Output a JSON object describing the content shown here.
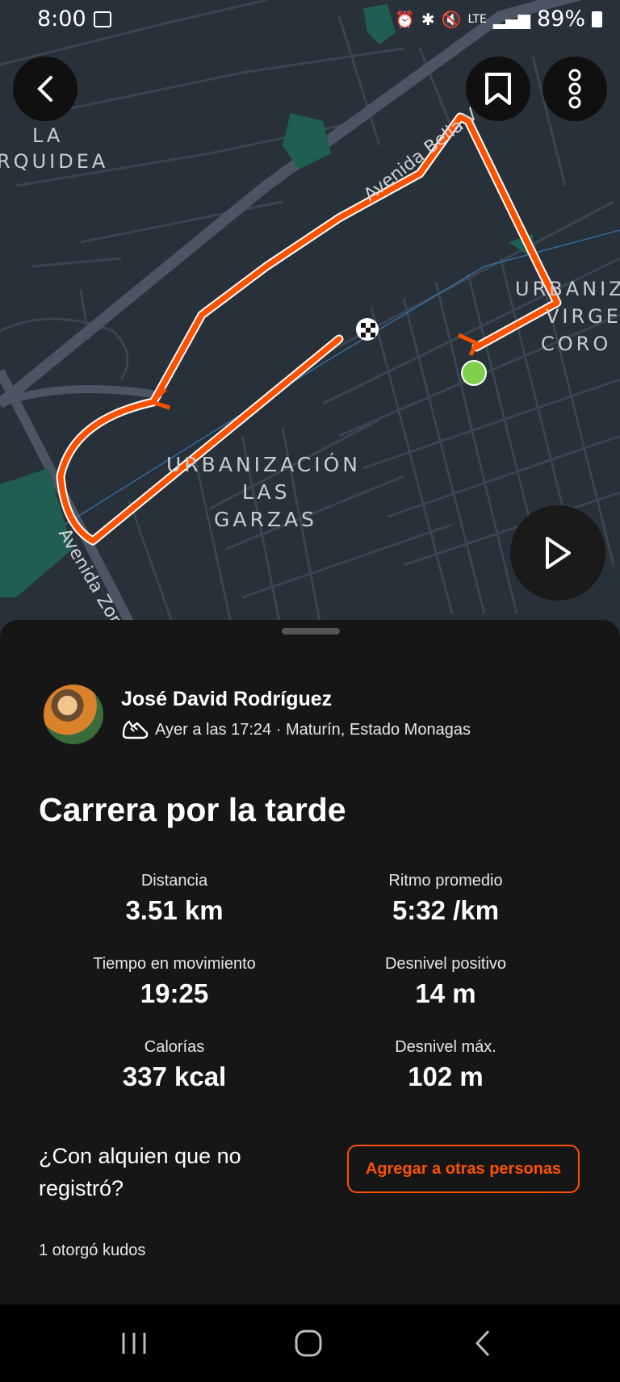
{
  "status_bar": {
    "time": "8:00",
    "net": "LTE",
    "battery": "89%"
  },
  "map": {
    "labels": {
      "la": "LA",
      "orquidea": "RQUIDEA",
      "avenida_bella": "Avenida Bella V",
      "urbaniz_1": "URBANIZ",
      "virge": "VIRGE",
      "coro": "CORO",
      "urb_garzas_1": "URBANIZACIÓN",
      "urb_garzas_2": "LAS",
      "urb_garzas_3": "GARZAS",
      "avenida_zon": "Avenida Zon"
    },
    "colors": {
      "route": "#fc5200",
      "start": "#7fd14a",
      "bg": "#283039",
      "park": "#1f5e51"
    }
  },
  "header": {
    "icons": [
      "back-icon",
      "bookmark-icon",
      "more-vertical-icon"
    ]
  },
  "activity": {
    "athlete_name": "José David Rodríguez",
    "meta": "Ayer a las 17:24 · Maturín, Estado Monagas",
    "title": "Carrera por la tarde",
    "stats": {
      "distance": {
        "label": "Distancia",
        "value": "3.51 km"
      },
      "pace": {
        "label": "Ritmo promedio",
        "value": "5:32 /km"
      },
      "moving_time": {
        "label": "Tiempo en movimiento",
        "value": "19:25"
      },
      "elevation_gain": {
        "label": "Desnivel positivo",
        "value": "14 m"
      },
      "calories": {
        "label": "Calorías",
        "value": "337 kcal"
      },
      "max_elevation": {
        "label": "Desnivel máx.",
        "value": "102 m"
      }
    },
    "tag_prompt": "¿Con alquien que no registró?",
    "add_others_label": "Agregar a otras personas",
    "kudos_text": "1 otorgó kudos"
  },
  "accent_color": "#fc5200"
}
